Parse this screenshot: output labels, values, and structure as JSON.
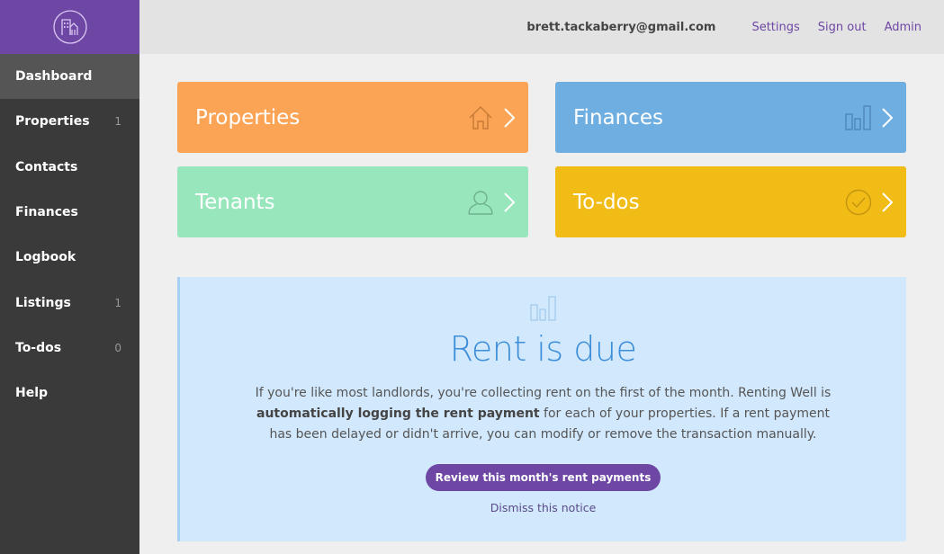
{
  "sidebar": {
    "logo": "buildings-logo",
    "items": [
      {
        "label": "Dashboard",
        "count": "",
        "active": true
      },
      {
        "label": "Properties",
        "count": "1"
      },
      {
        "label": "Contacts",
        "count": ""
      },
      {
        "label": "Finances",
        "count": ""
      },
      {
        "label": "Logbook",
        "count": ""
      },
      {
        "label": "Listings",
        "count": "1"
      },
      {
        "label": "To-dos",
        "count": "0"
      },
      {
        "label": "Help",
        "count": ""
      }
    ]
  },
  "topbar": {
    "email": "brett.tackaberry@gmail.com",
    "settings": "Settings",
    "signout": "Sign out",
    "admin": "Admin"
  },
  "tiles": [
    {
      "title": "Properties",
      "icon": "house-icon",
      "color": "#fba456"
    },
    {
      "title": "Finances",
      "icon": "bar-chart-icon",
      "color": "#6eaee0"
    },
    {
      "title": "Tenants",
      "icon": "person-icon",
      "color": "#98e6bc"
    },
    {
      "title": "To-dos",
      "icon": "check-circle-icon",
      "color": "#f2bc17"
    }
  ],
  "notice": {
    "icon": "bar-chart-icon",
    "title": "Rent is due",
    "body_1": "If you're like most landlords, you're collecting rent on the first of the month. Renting Well is ",
    "body_bold": "automatically logging the rent payment",
    "body_2": " for each of your properties. If a rent payment has been delayed or didn't arrive, you can modify or remove the transaction manually.",
    "button": "Review this month's rent payments",
    "dismiss": "Dismiss this notice"
  },
  "colors": {
    "brand": "#6e47a5",
    "sidebar": "#3a3a3a",
    "notice_bg": "#d2e8fd",
    "notice_title": "#3c8ed8"
  }
}
